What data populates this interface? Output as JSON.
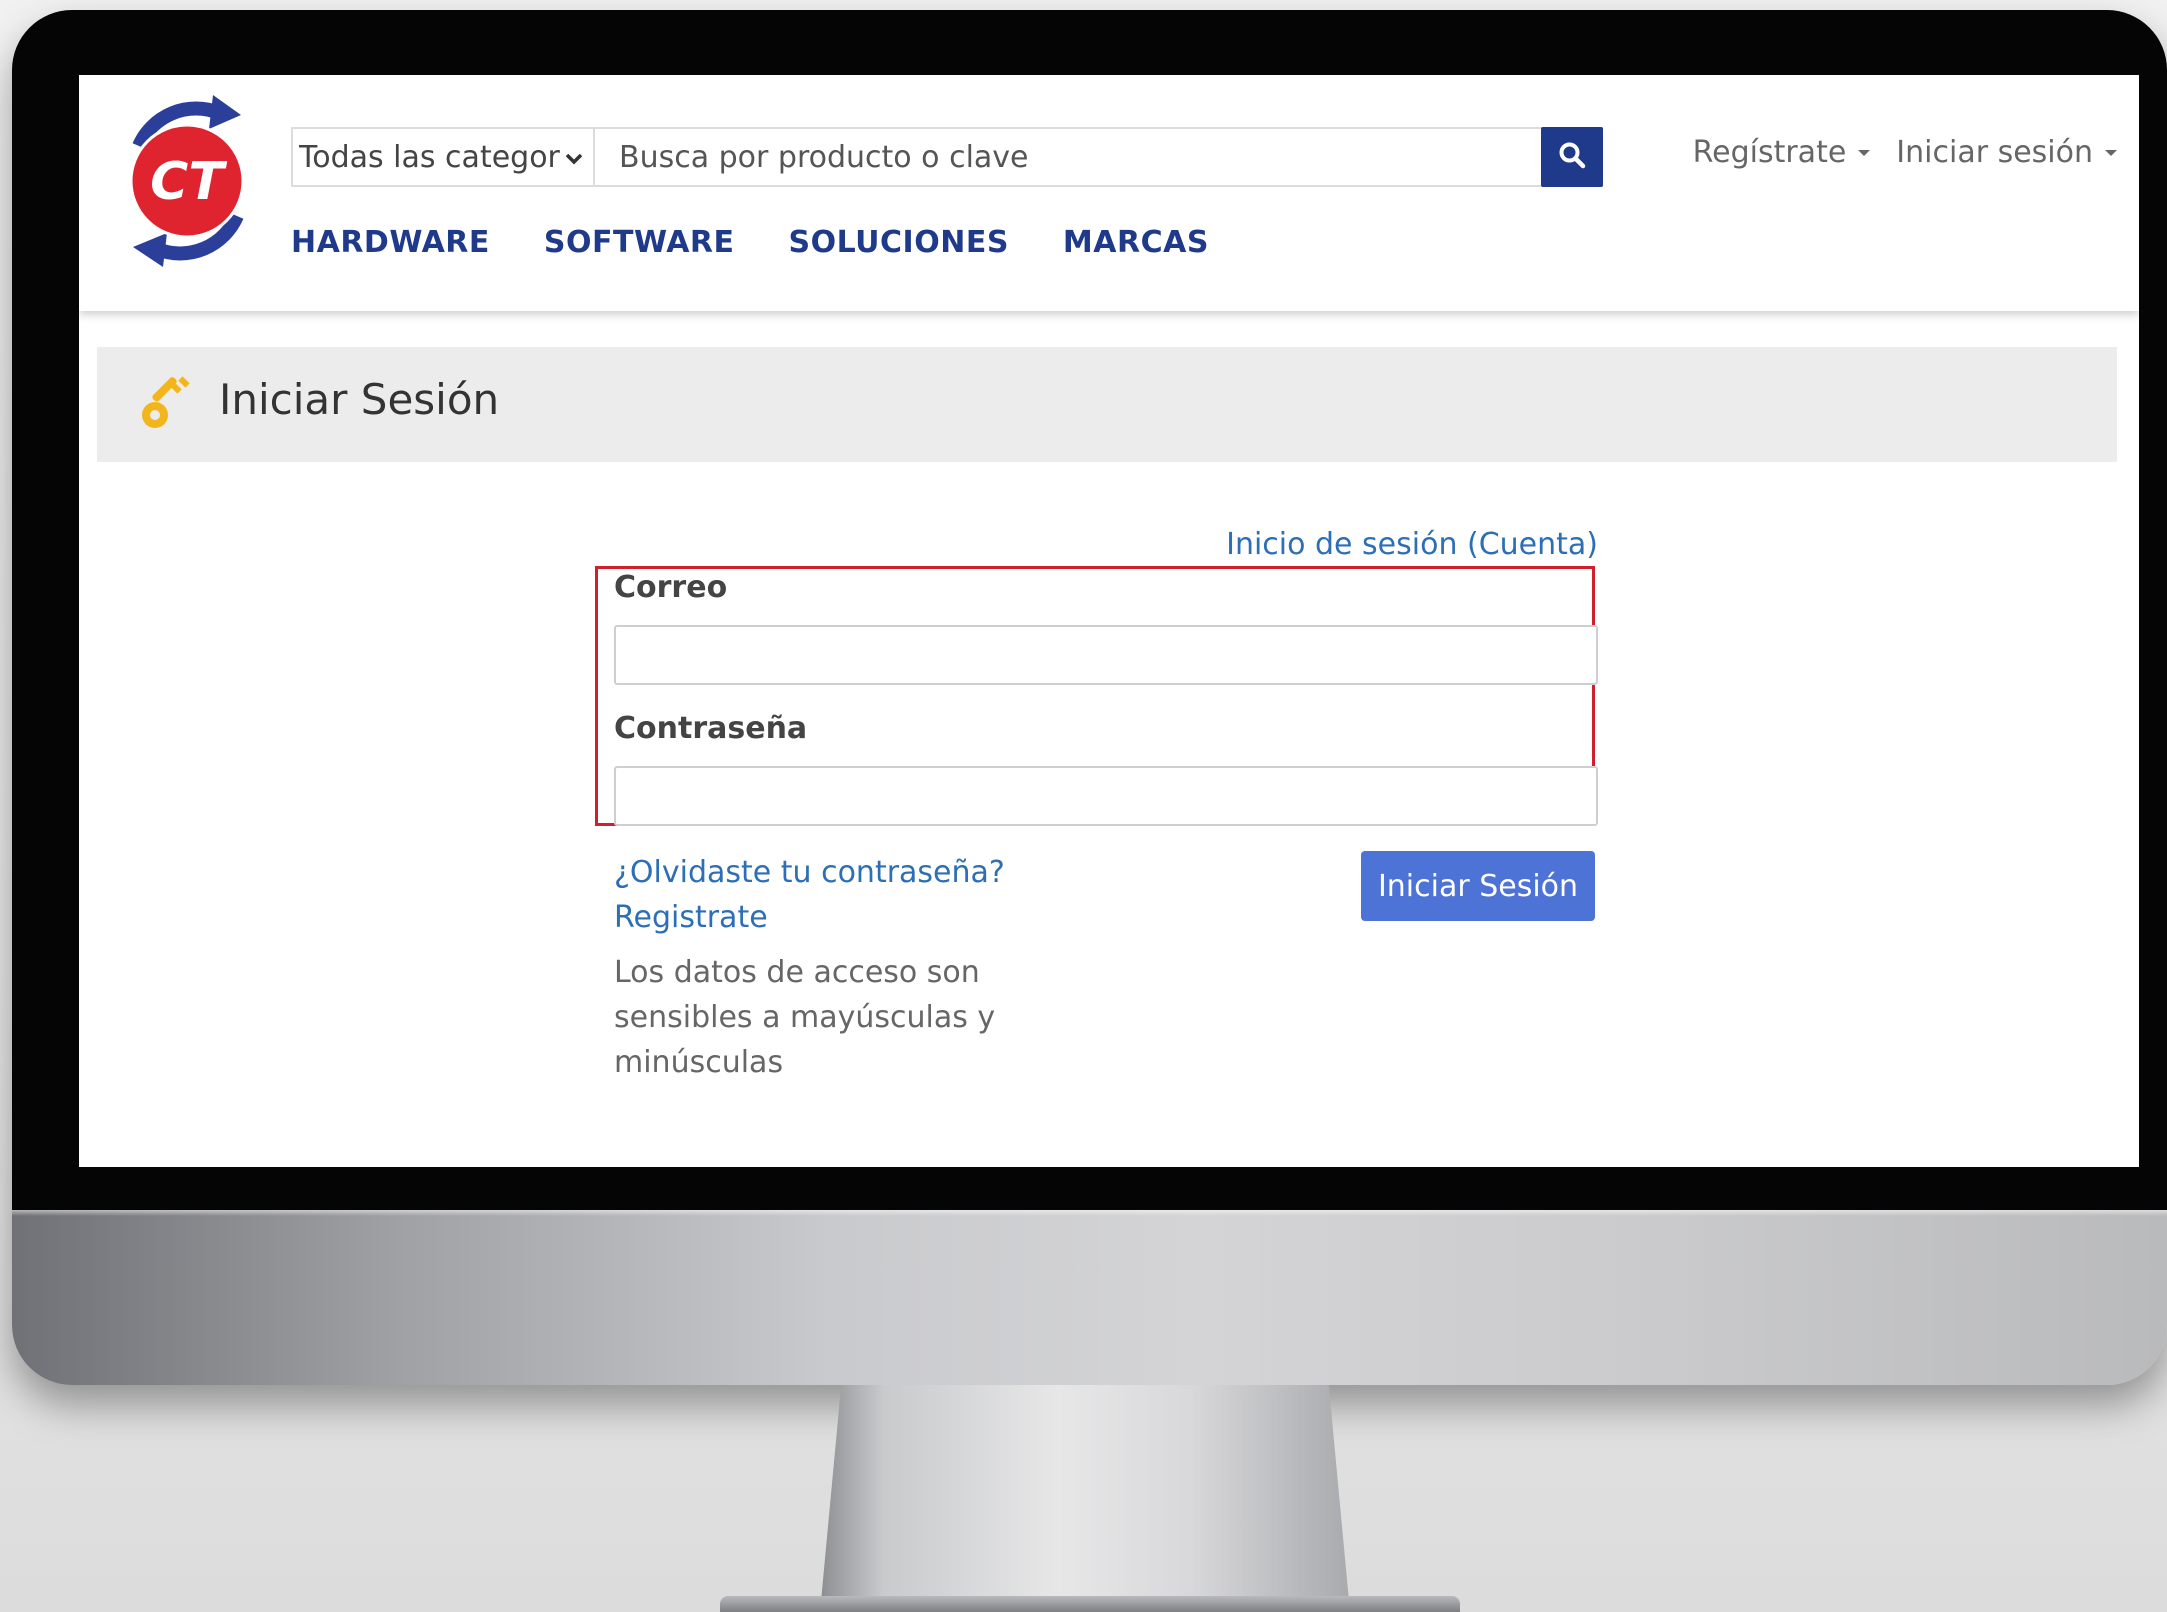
{
  "header": {
    "logo_text": "CT",
    "category_select": {
      "selected": "Todas las categorías"
    },
    "search": {
      "placeholder": "Busca por producto o clave"
    },
    "nav": [
      {
        "label": "HARDWARE"
      },
      {
        "label": "SOFTWARE"
      },
      {
        "label": "SOLUCIONES"
      },
      {
        "label": "MARCAS"
      }
    ],
    "top_links": {
      "register": "Regístrate",
      "login": "Iniciar sesión"
    }
  },
  "page": {
    "title": "Iniciar Sesión"
  },
  "form": {
    "account_link": "Inicio de sesión (Cuenta)",
    "email_label": "Correo",
    "email_value": "",
    "password_label": "Contraseña",
    "password_value": "",
    "forgot_link": "¿Olvidaste tu contraseña?",
    "register_link": "Registrate",
    "note": "Los datos de acceso son sensibles a mayúsculas y minúsculas",
    "submit_label": "Iniciar Sesión"
  },
  "colors": {
    "brand_navy": "#1f3a8a",
    "link_blue": "#2c6fb7",
    "button_blue": "#4e73d6",
    "highlight_red": "#d0202e",
    "logo_red": "#e0242f"
  },
  "icons": [
    "ct-logo",
    "chevron-down-icon",
    "search-icon",
    "caret-down-icon",
    "key-icon"
  ]
}
